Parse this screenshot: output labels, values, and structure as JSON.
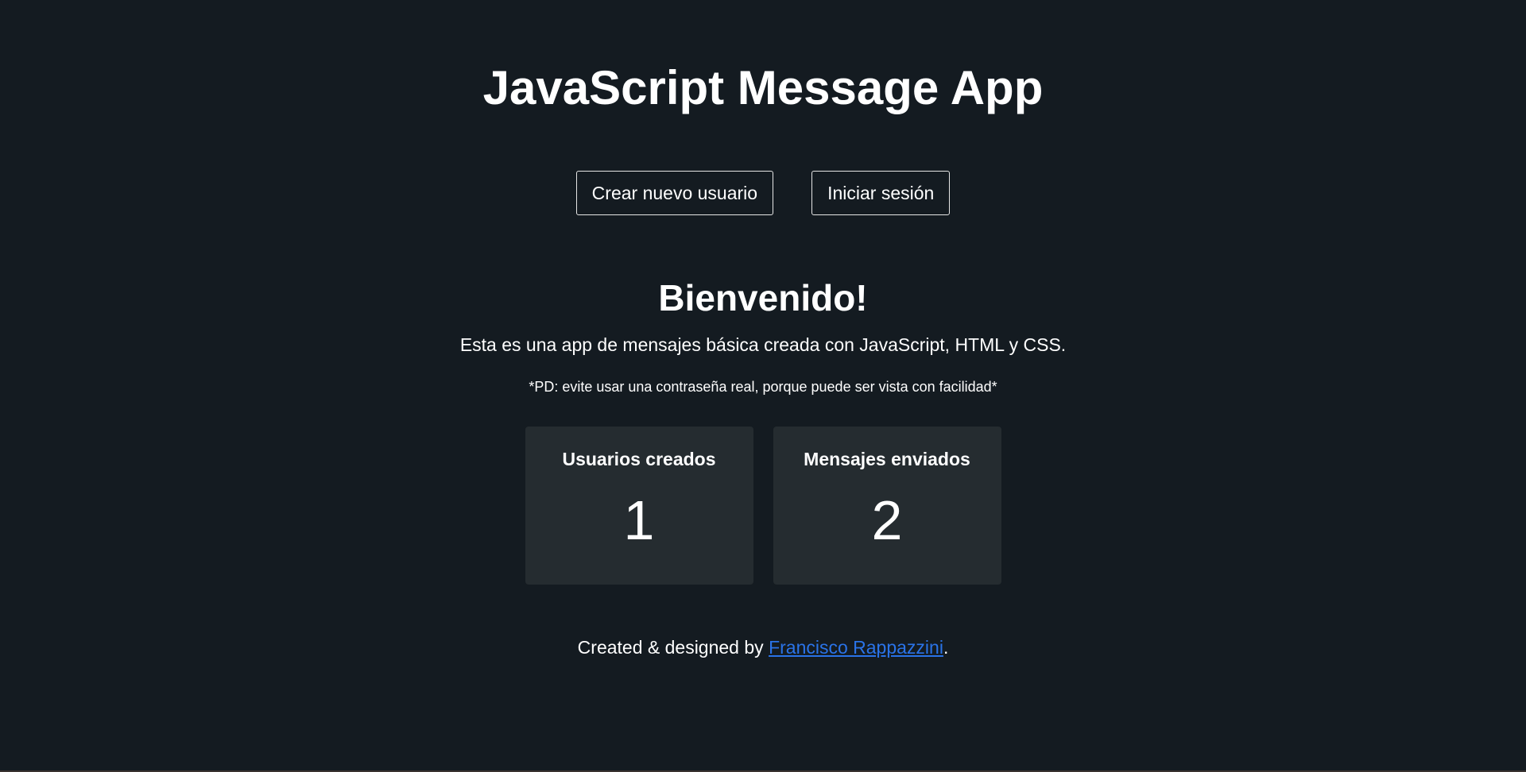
{
  "header": {
    "title": "JavaScript Message App"
  },
  "actions": {
    "create_user_label": "Crear nuevo usuario",
    "login_label": "Iniciar sesión"
  },
  "welcome": {
    "heading": "Bienvenido!",
    "description": "Esta es una app de mensajes básica creada con JavaScript, HTML y CSS.",
    "disclaimer": "*PD: evite usar una contraseña real, porque puede ser vista con facilidad*"
  },
  "stats": [
    {
      "label": "Usuarios creados",
      "value": "1"
    },
    {
      "label": "Mensajes enviados",
      "value": "2"
    }
  ],
  "footer": {
    "prefix": "Created & designed by ",
    "author_link": "Francisco Rappazzini",
    "suffix": "."
  },
  "colors": {
    "background": "#141b21",
    "card": "#252c30",
    "link": "#2a73e8",
    "text": "#ffffff"
  }
}
